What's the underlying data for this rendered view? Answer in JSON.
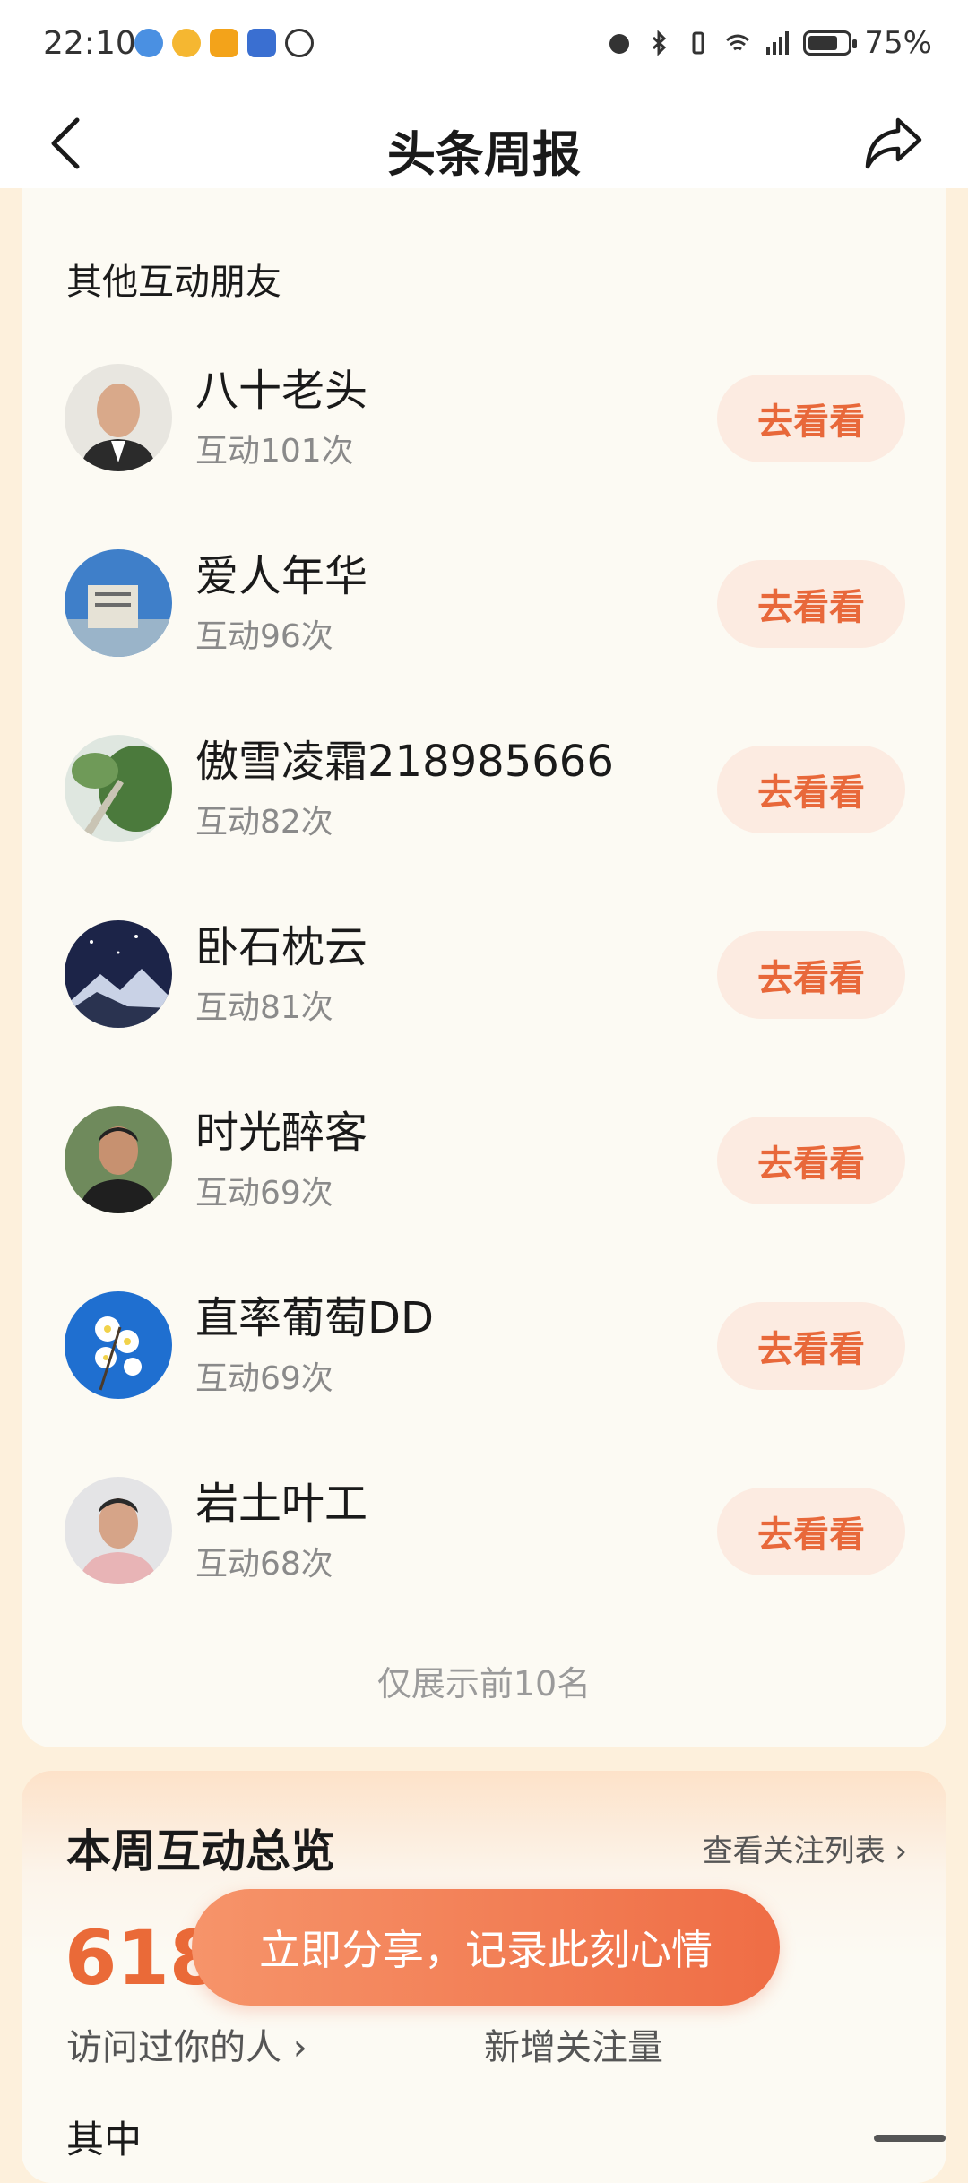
{
  "status_bar": {
    "time": "22:10",
    "battery": "75%",
    "battery_level": 0.75,
    "network": "4G"
  },
  "header": {
    "title": "头条周报",
    "back_icon": "chevron-left-icon",
    "share_icon": "share-arrow-icon"
  },
  "friends": {
    "section_title": "其他互动朋友",
    "button_label": "去看看",
    "items": [
      {
        "name": "八十老头",
        "count": "互动101次"
      },
      {
        "name": "爱人年华",
        "count": "互动96次"
      },
      {
        "name": "傲雪凌霜218985666",
        "count": "互动82次"
      },
      {
        "name": "卧石枕云",
        "count": "互动81次"
      },
      {
        "name": "时光醉客",
        "count": "互动69次"
      },
      {
        "name": "直率葡萄DD",
        "count": "互动69次"
      },
      {
        "name": "岩土叶工",
        "count": "互动68次"
      }
    ],
    "footnote": "仅展示前10名"
  },
  "overview": {
    "title": "本周互动总览",
    "follow_link": "查看关注列表 ›",
    "visitors_number": "618",
    "visitors_label": "访问过你的人 ›",
    "new_follow_label": "新增关注量",
    "sub_title": "其中"
  },
  "share_cta": "立即分享，记录此刻心情",
  "colors": {
    "accent": "#ea6a38",
    "button_bg": "#fcebe1",
    "page_bg": "#fdf0dc",
    "card_bg": "#fcfaf3"
  }
}
